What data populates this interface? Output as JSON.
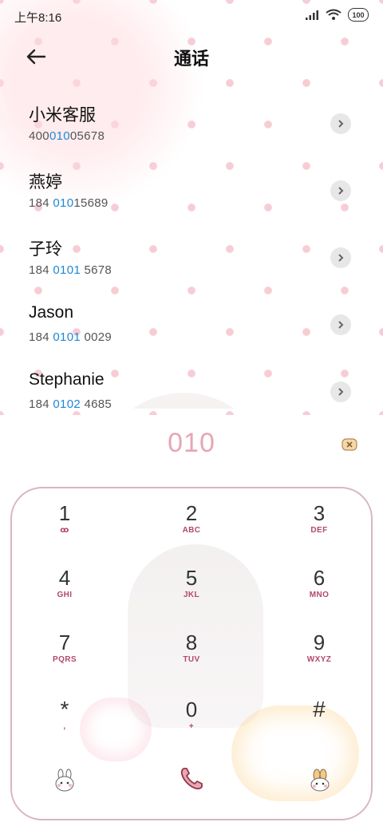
{
  "status": {
    "time": "上午8:16",
    "battery": "100"
  },
  "header": {
    "title": "通话"
  },
  "contacts": [
    {
      "name": "小米客服",
      "num_pre": "400",
      "num_hl": "010",
      "num_post": "05678"
    },
    {
      "name": "燕婷",
      "num_pre": "184 ",
      "num_hl": "010",
      "num_post": "15689"
    },
    {
      "name": "子玲",
      "num_pre": "184 ",
      "num_hl": "0101",
      "num_post": " 5678"
    },
    {
      "name": "Jason",
      "num_pre": "184 ",
      "num_hl": "0101",
      "num_post": " 0029"
    },
    {
      "name": "Stephanie",
      "num_pre": "184 ",
      "num_hl": "0102",
      "num_post": " 4685"
    }
  ],
  "dialed": "010",
  "keypad": [
    {
      "digit": "1",
      "letters": "ꝏ"
    },
    {
      "digit": "2",
      "letters": "ABC"
    },
    {
      "digit": "3",
      "letters": "DEF"
    },
    {
      "digit": "4",
      "letters": "GHI"
    },
    {
      "digit": "5",
      "letters": "JKL"
    },
    {
      "digit": "6",
      "letters": "MNO"
    },
    {
      "digit": "7",
      "letters": "PQRS"
    },
    {
      "digit": "8",
      "letters": "TUV"
    },
    {
      "digit": "9",
      "letters": "WXYZ"
    },
    {
      "digit": "*",
      "letters": ","
    },
    {
      "digit": "0",
      "letters": "+"
    },
    {
      "digit": "#",
      "letters": ""
    }
  ],
  "colors": {
    "accent": "#1e88d8",
    "dialed": "#e5a7b5",
    "keypad_border": "#d9b6c0",
    "letters": "#b14a6a"
  },
  "icons": {
    "back": "arrow-left-icon",
    "chevron": "chevron-right-icon",
    "delete": "backspace-icon",
    "call": "phone-icon"
  }
}
